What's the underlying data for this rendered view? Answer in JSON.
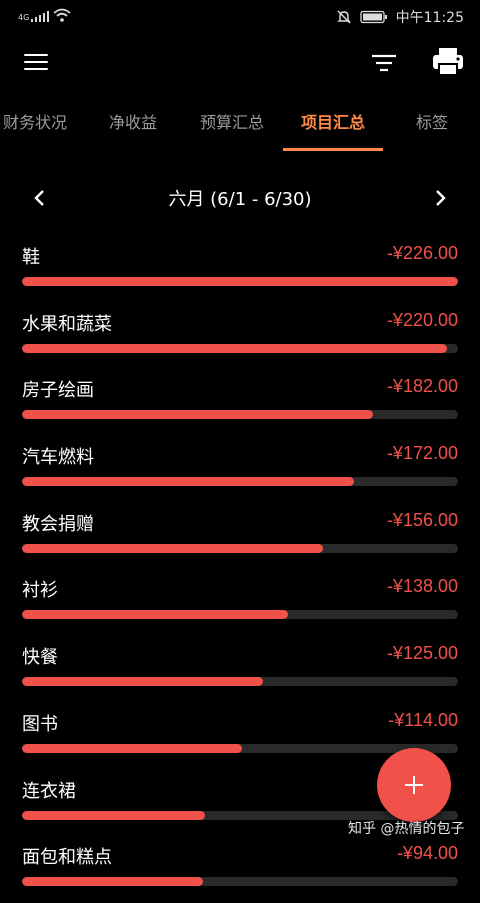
{
  "status_bar": {
    "network": "4G",
    "time": "中午11:25",
    "icons": [
      "signal-icon",
      "wifi-icon",
      "mute-icon",
      "battery-icon"
    ]
  },
  "toolbar": {
    "icons": [
      "menu-icon",
      "filter-icon",
      "print-icon"
    ]
  },
  "tabs": [
    {
      "label": "财务状况",
      "active": false
    },
    {
      "label": "净收益",
      "active": false
    },
    {
      "label": "预算汇总",
      "active": false
    },
    {
      "label": "项目汇总",
      "active": true
    },
    {
      "label": "标签",
      "active": false
    }
  ],
  "month_nav": {
    "label": "六月 (6/1 - 6/30)",
    "prev_icon": "chevron-left-icon",
    "next_icon": "chevron-right-icon"
  },
  "items": [
    {
      "name": "鞋",
      "amount": "-¥226.00",
      "progress": 1.0
    },
    {
      "name": "水果和蔬菜",
      "amount": "-¥220.00",
      "progress": 0.974
    },
    {
      "name": "房子绘画",
      "amount": "-¥182.00",
      "progress": 0.805
    },
    {
      "name": "汽车燃料",
      "amount": "-¥172.00",
      "progress": 0.761
    },
    {
      "name": "教会捐赠",
      "amount": "-¥156.00",
      "progress": 0.69
    },
    {
      "name": "衬衫",
      "amount": "-¥138.00",
      "progress": 0.611
    },
    {
      "name": "快餐",
      "amount": "-¥125.00",
      "progress": 0.553
    },
    {
      "name": "图书",
      "amount": "-¥114.00",
      "progress": 0.504
    },
    {
      "name": "连衣裙",
      "amount": "",
      "progress": 0.42
    },
    {
      "name": "面包和糕点",
      "amount": "-¥94.00",
      "progress": 0.416
    }
  ],
  "fab": {
    "icon": "plus-icon"
  },
  "watermark": "知乎 @热情的包子",
  "colors": {
    "background": "#000000",
    "accent": "#ff8a48",
    "expense": "#f0514a",
    "track": "#2a2a2a",
    "inactive_tab": "#9a9a9a"
  }
}
